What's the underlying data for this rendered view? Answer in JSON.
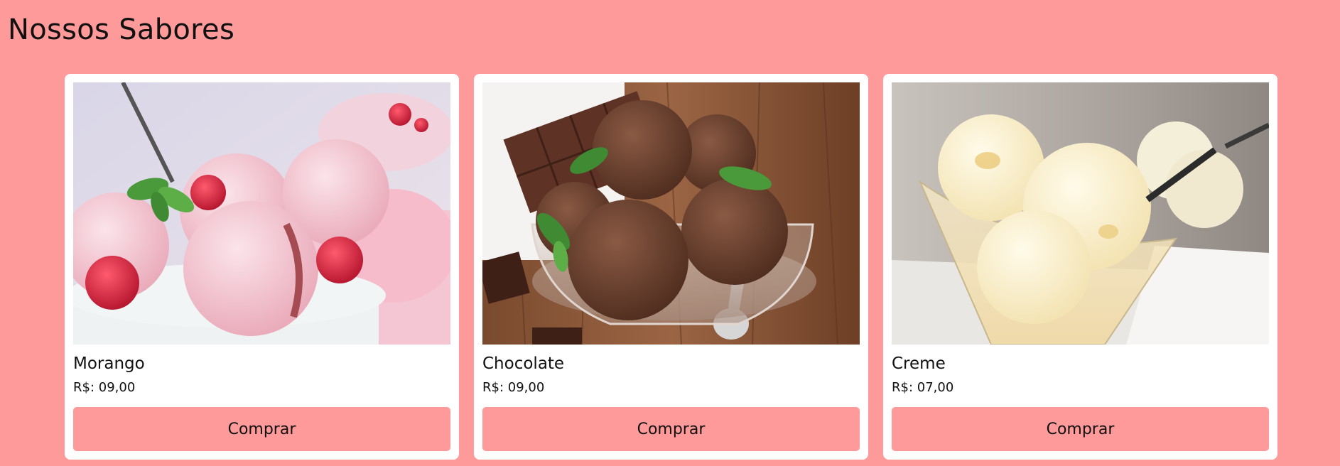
{
  "header": {
    "title": "Nossos Sabores"
  },
  "products": [
    {
      "name": "Morango",
      "price": "R$: 09,00",
      "button_label": "Comprar",
      "image_alt": "Sorvete de morango"
    },
    {
      "name": "Chocolate",
      "price": "R$: 09,00",
      "button_label": "Comprar",
      "image_alt": "Sorvete de chocolate"
    },
    {
      "name": "Creme",
      "price": "R$: 07,00",
      "button_label": "Comprar",
      "image_alt": "Sorvete de creme"
    }
  ],
  "colors": {
    "page_background": "#ff9a9a",
    "card_background": "#ffffff",
    "button_background": "#ff9a9a",
    "text": "#111111"
  }
}
